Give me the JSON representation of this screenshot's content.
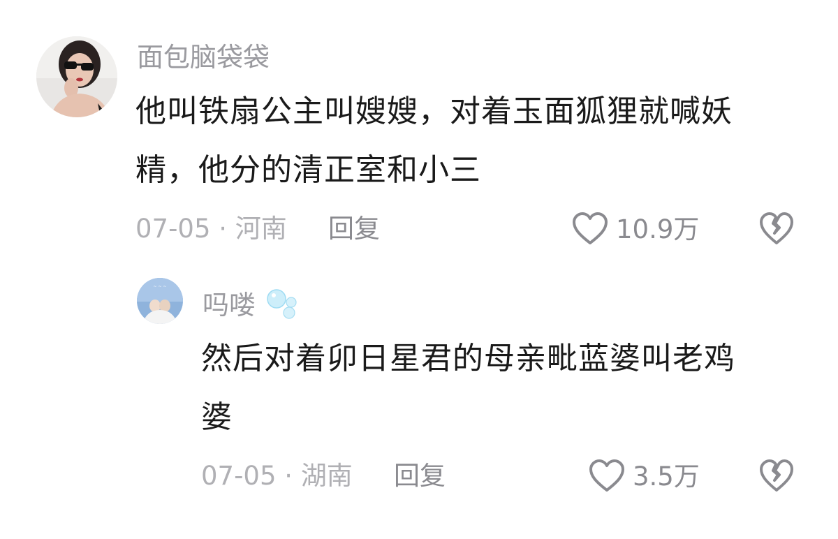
{
  "comments": [
    {
      "username": "面包脑袋袋",
      "text_line1": "他叫铁扇公主叫嫂嫂，对着玉面狐狸就喊妖",
      "text_line2": "精，他分的清正室和小三",
      "date": "07-05",
      "location": "河南",
      "meta_sep": "·",
      "reply_label": "回复",
      "like_count": "10.9万"
    },
    {
      "username": "吗喽",
      "text_line1": "然后对着卯日星君的母亲毗蓝婆叫老鸡",
      "text_line2": "婆",
      "date": "07-05",
      "location": "湖南",
      "meta_sep": "·",
      "reply_label": "回复",
      "like_count": "3.5万"
    }
  ],
  "icons": {
    "like": "heart-outline-icon",
    "dislike": "broken-heart-icon",
    "bubbles": "bubbles-emoji-icon"
  },
  "colors": {
    "username": "#9a9a9f",
    "text": "#1a1a1a",
    "meta": "#b0b0b4",
    "icon": "#8a8a8f"
  }
}
